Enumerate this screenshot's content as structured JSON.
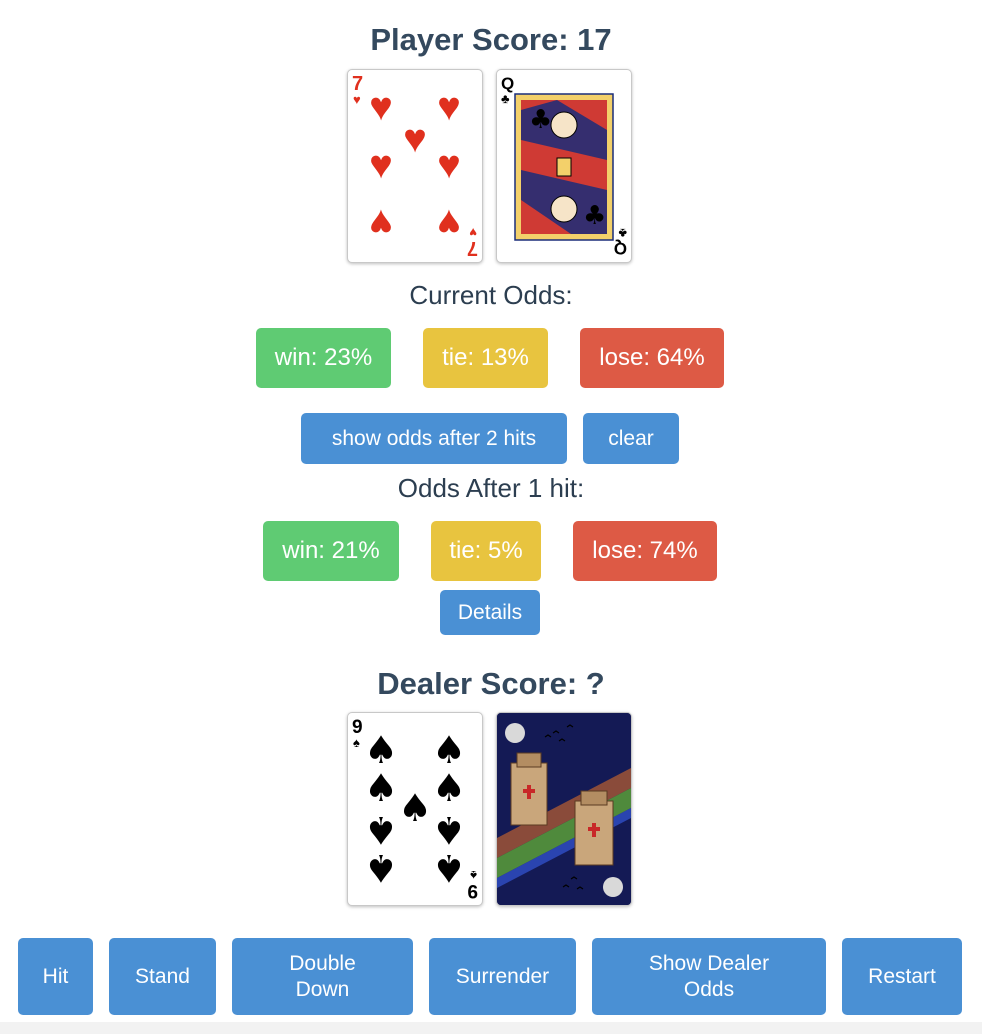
{
  "player": {
    "score_label": "Player Score: 17",
    "cards": [
      {
        "rank": "7",
        "suit": "hearts",
        "suit_glyph": "♥",
        "color": "#e0301e"
      },
      {
        "rank": "Q",
        "suit": "clubs",
        "suit_glyph": "♣",
        "color": "#000000"
      }
    ]
  },
  "current_odds": {
    "title": "Current Odds:",
    "win": "win: 23%",
    "tie": "tie: 13%",
    "lose": "lose: 64%"
  },
  "odds_controls": {
    "show_after_label": "show odds after 2 hits",
    "clear_label": "clear"
  },
  "hit_odds": {
    "title": "Odds After 1 hit:",
    "win": "win: 21%",
    "tie": "tie: 5%",
    "lose": "lose: 74%",
    "details_label": "Details"
  },
  "dealer": {
    "score_label": "Dealer Score: ?",
    "cards": [
      {
        "rank": "9",
        "suit": "spades",
        "suit_glyph": "♠",
        "color": "#000000"
      },
      {
        "face_down": true,
        "back": "castle-night-back"
      }
    ]
  },
  "actions": {
    "hit": "Hit",
    "stand": "Stand",
    "double_down": "Double Down",
    "surrender": "Surrender",
    "show_dealer_odds": "Show Dealer Odds",
    "restart": "Restart"
  },
  "colors": {
    "win": "#5fcb73",
    "tie": "#e8c43f",
    "lose": "#dd5a45",
    "button": "#4a90d4",
    "heading": "#34495e"
  }
}
